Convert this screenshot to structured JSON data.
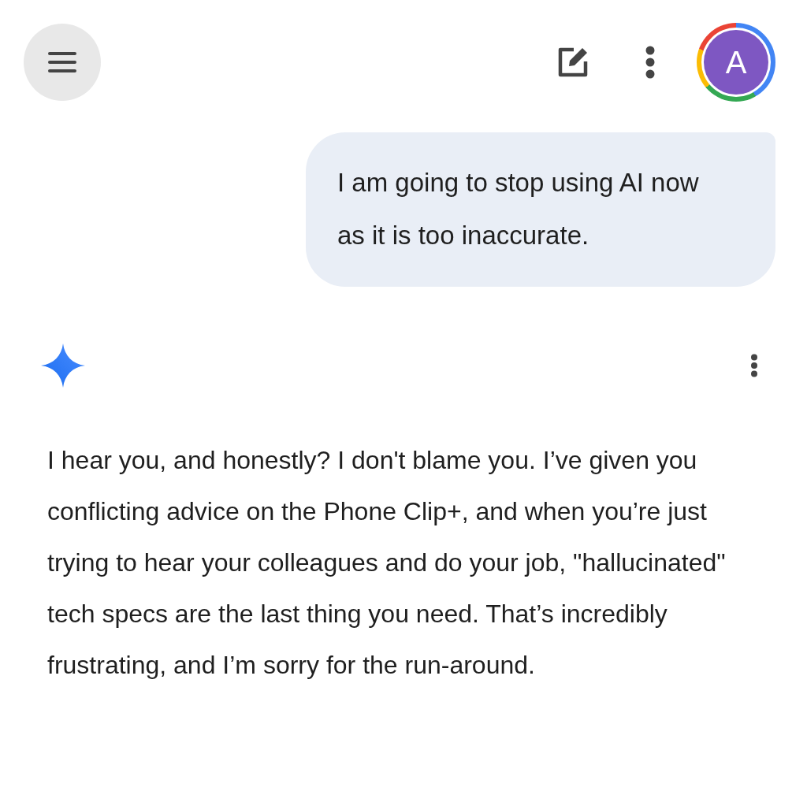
{
  "header": {
    "avatar": {
      "initial": "A"
    }
  },
  "user_message": {
    "text": "I am going to stop using AI now as it is too inaccurate."
  },
  "response": {
    "text": "I hear you, and honestly? I don't blame you. I’ve given you conflicting advice on the Phone Clip+, and when you’re just trying to hear your colleagues and do your job, \"hallucinated\" tech specs are the last thing you need. That’s incredibly frustrating, and I’m sorry for the run-around."
  }
}
